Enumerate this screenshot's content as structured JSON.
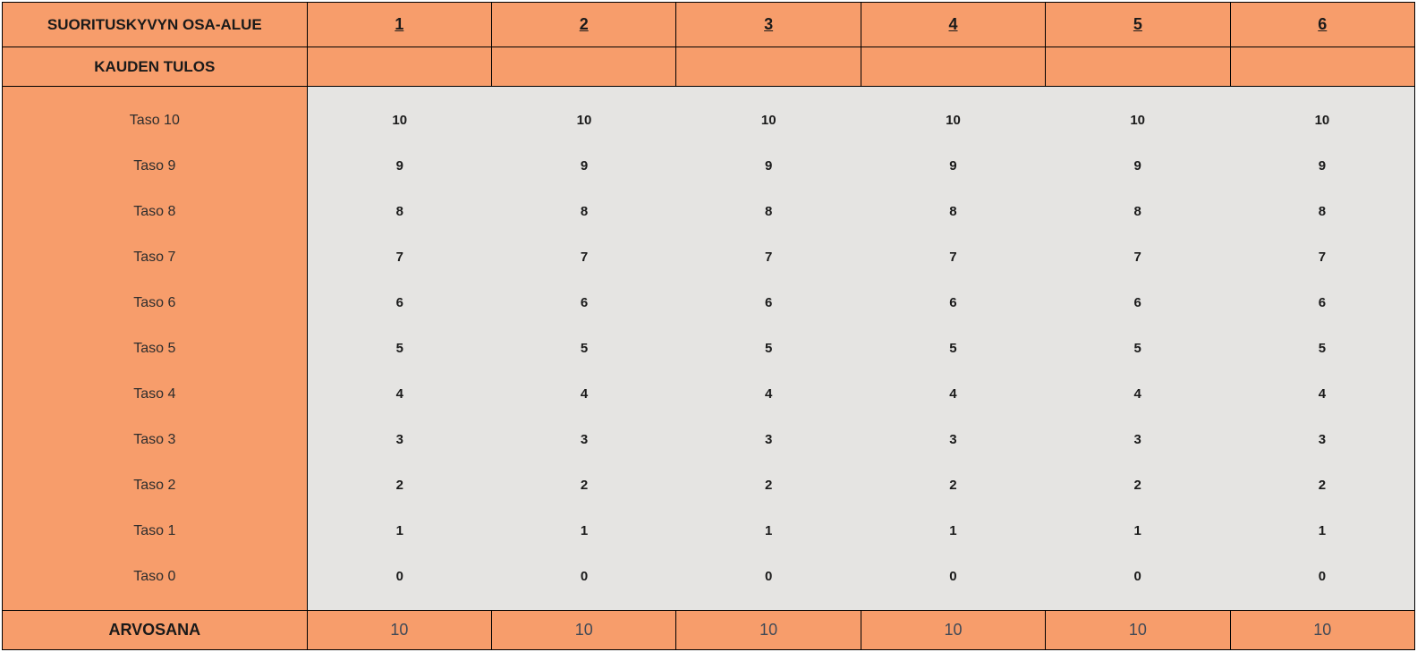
{
  "headers": {
    "area_label": "SUORITUSKYVYN OSA-ALUE",
    "season_result": "KAUDEN TULOS",
    "grade": "ARVOSANA",
    "cols": [
      "1",
      "2",
      "3",
      "4",
      "5",
      "6"
    ]
  },
  "levels_labels": [
    "Taso 10",
    "Taso 9",
    "Taso 8",
    "Taso 7",
    "Taso 6",
    "Taso 5",
    "Taso 4",
    "Taso 3",
    "Taso 2",
    "Taso 1",
    "Taso 0"
  ],
  "levels_values": {
    "col1": [
      "10",
      "9",
      "8",
      "7",
      "6",
      "5",
      "4",
      "3",
      "2",
      "1",
      "0"
    ],
    "col2": [
      "10",
      "9",
      "8",
      "7",
      "6",
      "5",
      "4",
      "3",
      "2",
      "1",
      "0"
    ],
    "col3": [
      "10",
      "9",
      "8",
      "7",
      "6",
      "5",
      "4",
      "3",
      "2",
      "1",
      "0"
    ],
    "col4": [
      "10",
      "9",
      "8",
      "7",
      "6",
      "5",
      "4",
      "3",
      "2",
      "1",
      "0"
    ],
    "col5": [
      "10",
      "9",
      "8",
      "7",
      "6",
      "5",
      "4",
      "3",
      "2",
      "1",
      "0"
    ],
    "col6": [
      "10",
      "9",
      "8",
      "7",
      "6",
      "5",
      "4",
      "3",
      "2",
      "1",
      "0"
    ]
  },
  "grades": [
    "10",
    "10",
    "10",
    "10",
    "10",
    "10"
  ]
}
